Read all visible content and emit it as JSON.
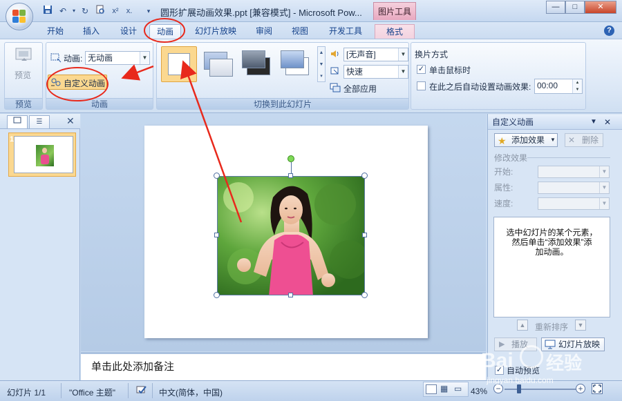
{
  "window": {
    "title": "圆形扩展动画效果.ppt [兼容模式] - Microsoft Pow...",
    "context_tool": "图片工具",
    "minimize": "—",
    "maximize": "□",
    "close": "✕"
  },
  "quick_access": [
    "save-icon",
    "undo-icon",
    "redo-icon",
    "print-preview-icon",
    "format-painter-icon",
    "customize-icon"
  ],
  "tabs": [
    {
      "label": "开始",
      "active": false
    },
    {
      "label": "插入",
      "active": false
    },
    {
      "label": "设计",
      "active": false
    },
    {
      "label": "动画",
      "active": true
    },
    {
      "label": "幻灯片放映",
      "active": false
    },
    {
      "label": "审阅",
      "active": false
    },
    {
      "label": "视图",
      "active": false
    },
    {
      "label": "开发工具",
      "active": false
    },
    {
      "label": "格式",
      "active": false
    }
  ],
  "ribbon": {
    "preview_group": {
      "button": "预览",
      "label": "预览"
    },
    "animation_group": {
      "label": "动画",
      "animate_label": "动画:",
      "animate_value": "无动画",
      "custom_animation": "自定义动画"
    },
    "transition_group": {
      "label": "切换到此幻灯片",
      "sound_value": "[无声音]",
      "speed_value": "快速",
      "apply_all": "全部应用"
    },
    "advance_group": {
      "title": "换片方式",
      "on_click": "单击鼠标时",
      "on_click_checked": true,
      "auto_after": "在此之后自动设置动画效果:",
      "auto_after_checked": false,
      "time_value": "00:00"
    }
  },
  "left_panel": {
    "slide_number": "1"
  },
  "notes": {
    "placeholder": "单击此处添加备注"
  },
  "task_pane": {
    "title": "自定义动画",
    "add_effect": "添加效果",
    "remove": "删除",
    "modify_title": "修改效果",
    "start_label": "开始:",
    "property_label": "属性:",
    "speed_label": "速度:",
    "hint": "选中幻灯片的某个元素，\n然后单击“添加效果”添\n加动画。",
    "reorder": "重新排序",
    "play": "播放",
    "slideshow": "幻灯片放映",
    "autopreview": "自动预览",
    "autopreview_checked": true
  },
  "status_bar": {
    "slide_info": "幻灯片 1/1",
    "theme": "\"Office 主题\"",
    "language": "中文(简体，中国)",
    "zoom": "43%"
  },
  "watermark": {
    "brand": "Bai",
    "brand_tail": "经验",
    "url": "jingyan.baidu.com"
  },
  "colors": {
    "accent": "#15428b",
    "annotation_red": "#e8291c",
    "active_button_fill": "#fbd890",
    "context_tab": "#e8a9c0"
  }
}
